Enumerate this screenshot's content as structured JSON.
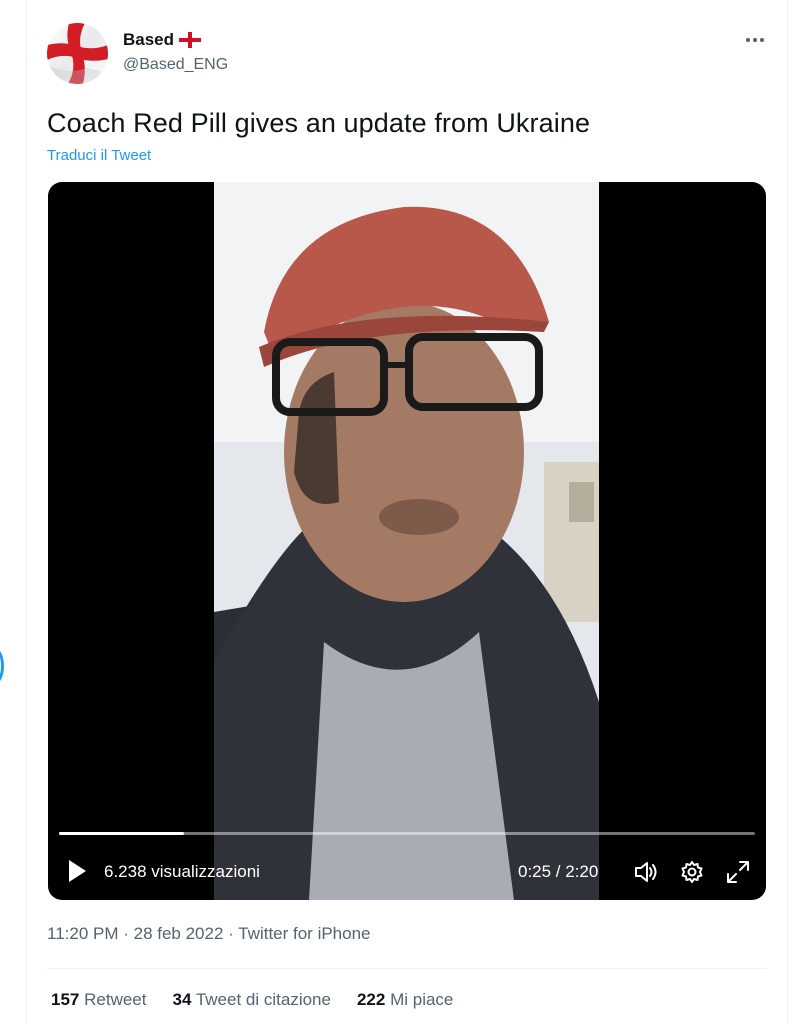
{
  "author": {
    "display_name": "Based",
    "handle": "@Based_ENG",
    "flag_icon": "england-flag-icon"
  },
  "tweet": {
    "text": "Coach Red Pill gives an update from Ukraine",
    "translate_label": "Traduci il Tweet"
  },
  "video": {
    "views": "6.238 visualizzazioni",
    "time": "0:25 / 2:20",
    "progress": 0.18
  },
  "meta": {
    "timestamp": "11:20 PM · 28 feb 2022 · Twitter for iPhone"
  },
  "stats": {
    "retweets_count": "157",
    "retweets_label": "Retweet",
    "quotes_count": "34",
    "quotes_label": "Tweet di citazione",
    "likes_count": "222",
    "likes_label": "Mi piace"
  },
  "colors": {
    "link": "#1d9bf0",
    "secondary_text": "#536471",
    "flag_red": "#ce1124"
  }
}
